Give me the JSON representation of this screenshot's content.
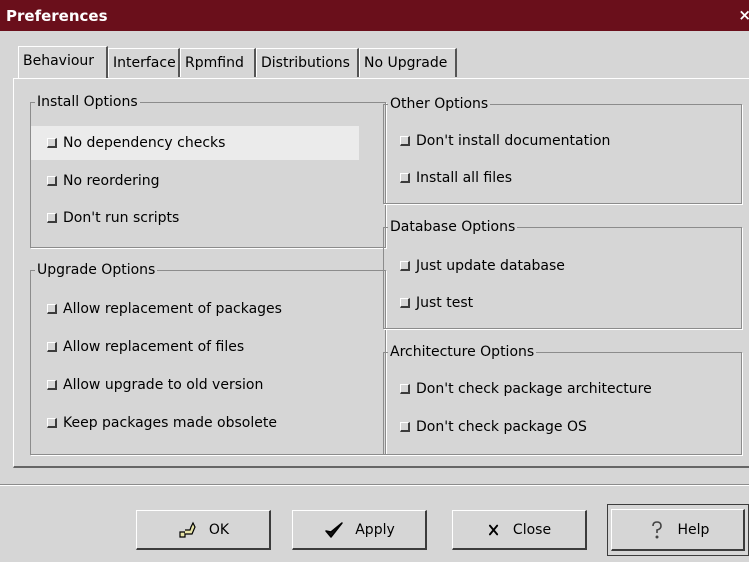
{
  "window": {
    "title": "Preferences",
    "close_glyph": "×"
  },
  "tabs": [
    {
      "label": "Behaviour"
    },
    {
      "label": "Interface"
    },
    {
      "label": "Rpmfind"
    },
    {
      "label": "Distributions"
    },
    {
      "label": "No Upgrade"
    }
  ],
  "install_options": {
    "title": "Install Options",
    "items": [
      "No dependency checks",
      "No reordering",
      "Don't run scripts"
    ]
  },
  "upgrade_options": {
    "title": "Upgrade Options",
    "items": [
      "Allow replacement of packages",
      "Allow replacement of files",
      "Allow upgrade to old version",
      "Keep packages made obsolete"
    ]
  },
  "other_options": {
    "title": "Other Options",
    "items": [
      "Don't install documentation",
      "Install all files"
    ]
  },
  "database_options": {
    "title": "Database Options",
    "items": [
      "Just update database",
      "Just test"
    ]
  },
  "architecture_options": {
    "title": "Architecture Options",
    "items": [
      "Don't check package architecture",
      "Don't check package OS"
    ]
  },
  "buttons": {
    "ok": {
      "label": "OK",
      "icon": "ok-icon"
    },
    "apply": {
      "label": "Apply",
      "icon": "checkmark-icon"
    },
    "close": {
      "label": "Close",
      "icon": "x-icon"
    },
    "help": {
      "label": "Help",
      "icon": "help-icon"
    }
  },
  "colors": {
    "titlebar": "#6a0f1b",
    "window_bg": "#d6d6d6"
  }
}
